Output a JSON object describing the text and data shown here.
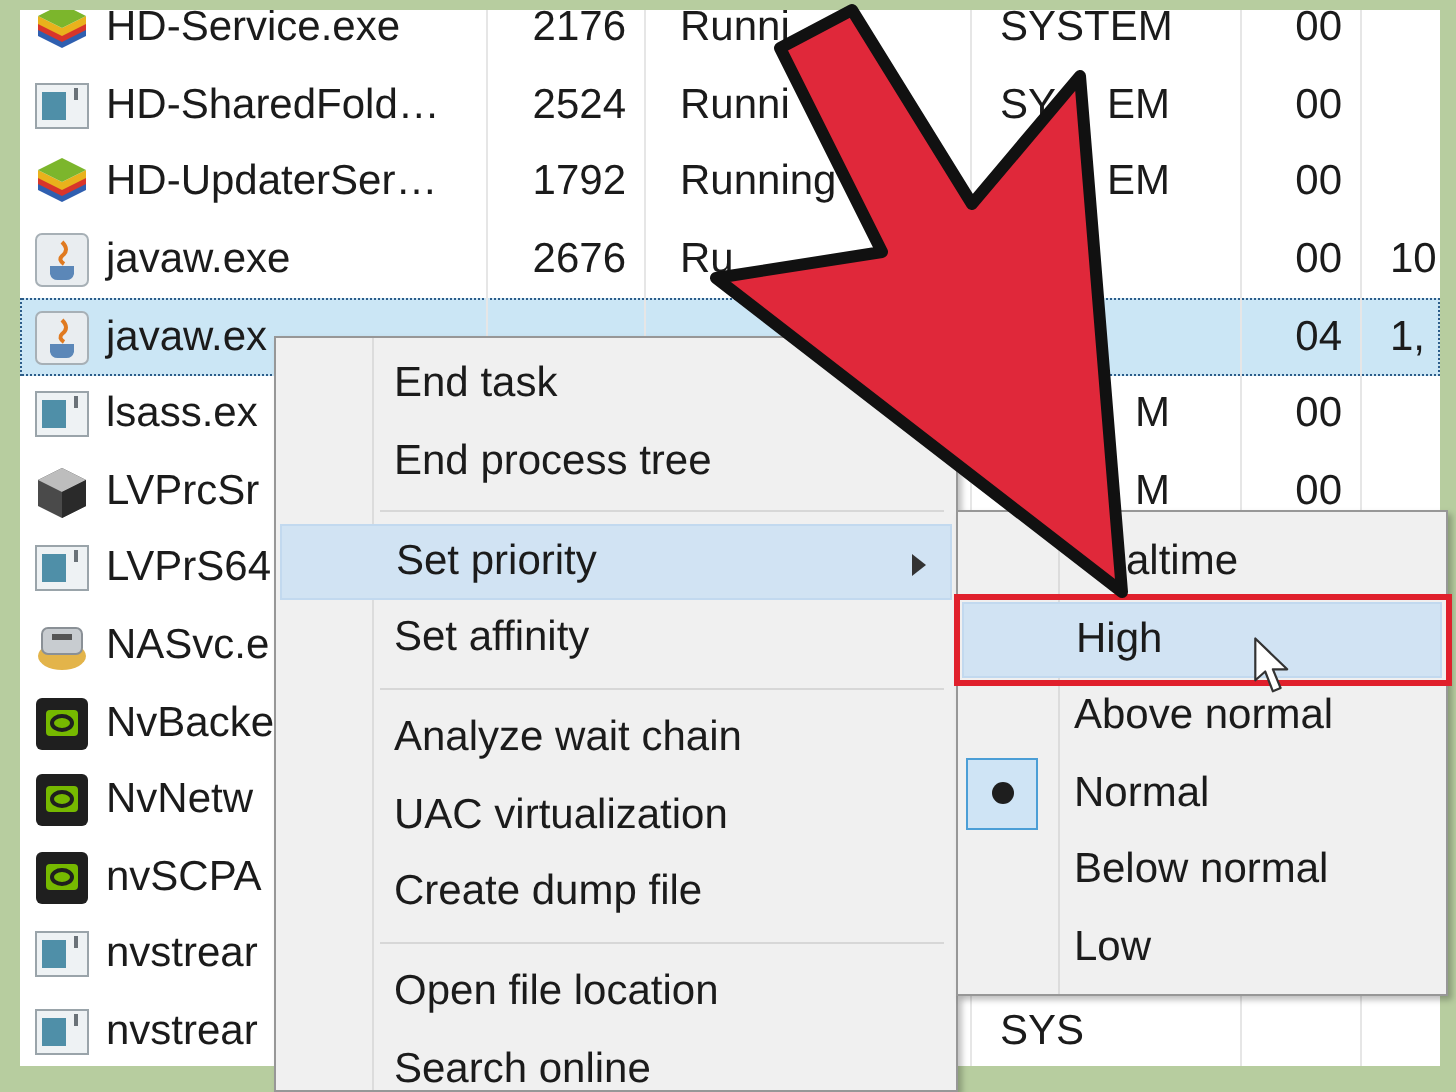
{
  "processes": [
    {
      "kind": "stack",
      "name": "HD-Service.exe",
      "pid": "2176",
      "status": "Runni",
      "user": "SYSTEM",
      "cpu": "00",
      "selected": false
    },
    {
      "kind": "app",
      "name": "HD-SharedFold…",
      "pid": "2524",
      "status": "Runni",
      "user": "SY",
      "user_end": "EM",
      "cpu": "00",
      "selected": false
    },
    {
      "kind": "stack",
      "name": "HD-UpdaterSer…",
      "pid": "1792",
      "status": "Running",
      "user_end": "EM",
      "cpu": "00",
      "selected": false
    },
    {
      "kind": "java",
      "name": "javaw.exe",
      "pid": "2676",
      "status": "Ru",
      "cpu": "00",
      "memory": "10",
      "selected": false
    },
    {
      "kind": "java",
      "name": "javaw.ex",
      "cpu": "04",
      "memory": "1,",
      "selected": true
    },
    {
      "kind": "app",
      "name": "lsass.ex",
      "user_end": "M",
      "cpu": "00",
      "selected": false
    },
    {
      "kind": "cube",
      "name": "LVPrcSr",
      "user_end": "M",
      "cpu": "00",
      "selected": false
    },
    {
      "kind": "app",
      "name": "LVPrS64",
      "selected": false
    },
    {
      "kind": "disk",
      "name": "NASvc.e",
      "selected": false
    },
    {
      "kind": "chip",
      "name": "NvBacke",
      "selected": false
    },
    {
      "kind": "chip",
      "name": "NvNetw",
      "selected": false
    },
    {
      "kind": "chip",
      "name": "nvSCPA",
      "selected": false
    },
    {
      "kind": "app",
      "name": "nvstrear",
      "selected": false
    },
    {
      "kind": "app",
      "name": "nvstrear",
      "user": "SYS",
      "selected": false
    }
  ],
  "context_menu": {
    "items": [
      {
        "kind": "item",
        "label": "End task",
        "hovered": false
      },
      {
        "kind": "item",
        "label": "End process tree",
        "hovered": false
      },
      {
        "kind": "separator"
      },
      {
        "kind": "submenu",
        "label": "Set priority",
        "hovered": true
      },
      {
        "kind": "item",
        "label": "Set affinity",
        "hovered": false
      },
      {
        "kind": "separator"
      },
      {
        "kind": "item",
        "label": "Analyze wait chain",
        "hovered": false
      },
      {
        "kind": "item",
        "label": "UAC virtualization",
        "hovered": false
      },
      {
        "kind": "item",
        "label": "Create dump file",
        "hovered": false
      },
      {
        "kind": "separator"
      },
      {
        "kind": "item",
        "label": "Open file location",
        "hovered": false
      },
      {
        "kind": "item",
        "label": "Search online",
        "hovered": false
      }
    ]
  },
  "priority_menu": {
    "items": [
      {
        "label": "altime",
        "checked": false,
        "hovered": false,
        "outlined": false
      },
      {
        "label": "High",
        "checked": false,
        "hovered": true,
        "outlined": true
      },
      {
        "label": "Above normal",
        "checked": false,
        "hovered": false,
        "outlined": false
      },
      {
        "label": "Normal",
        "checked": true,
        "hovered": false,
        "outlined": false
      },
      {
        "label": "Below normal",
        "checked": false,
        "hovered": false,
        "outlined": false
      },
      {
        "label": "Low",
        "checked": false,
        "hovered": false,
        "outlined": false
      }
    ]
  }
}
